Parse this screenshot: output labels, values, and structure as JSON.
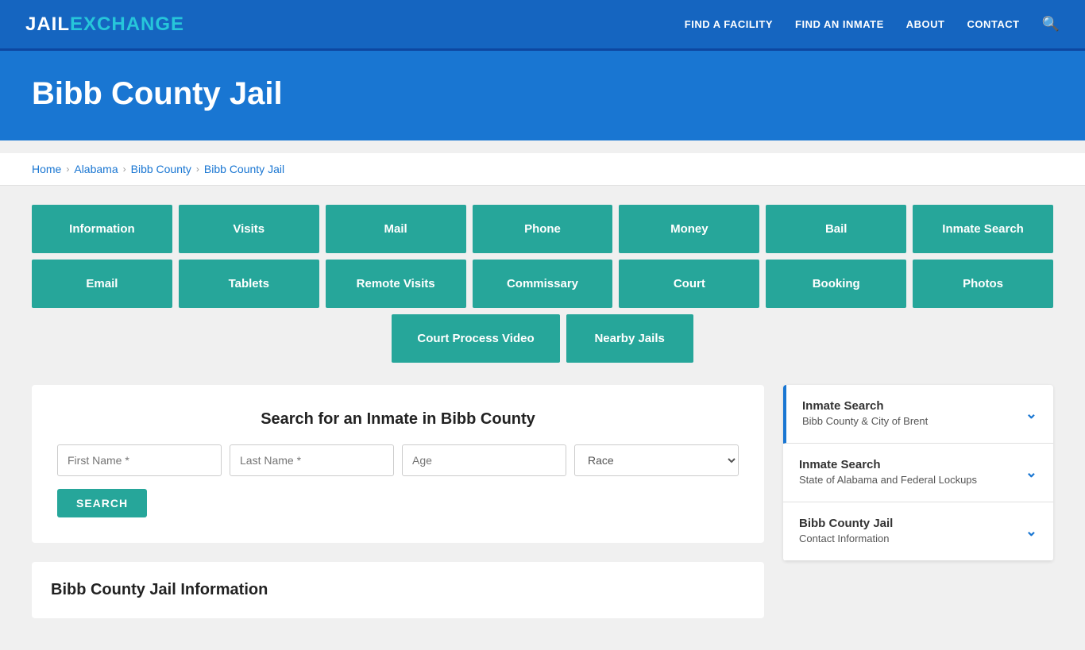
{
  "brand": {
    "jail": "JAIL",
    "exchange": "EXCHANGE"
  },
  "nav": {
    "items": [
      {
        "label": "FIND A FACILITY",
        "id": "find-facility"
      },
      {
        "label": "FIND AN INMATE",
        "id": "find-inmate"
      },
      {
        "label": "ABOUT",
        "id": "about"
      },
      {
        "label": "CONTACT",
        "id": "contact"
      }
    ]
  },
  "hero": {
    "title": "Bibb County Jail"
  },
  "breadcrumb": {
    "items": [
      {
        "label": "Home",
        "href": "#"
      },
      {
        "label": "Alabama",
        "href": "#"
      },
      {
        "label": "Bibb County",
        "href": "#"
      },
      {
        "label": "Bibb County Jail",
        "href": "#"
      }
    ]
  },
  "navButtons": {
    "row1": [
      {
        "label": "Information"
      },
      {
        "label": "Visits"
      },
      {
        "label": "Mail"
      },
      {
        "label": "Phone"
      },
      {
        "label": "Money"
      },
      {
        "label": "Bail"
      },
      {
        "label": "Inmate Search"
      }
    ],
    "row2": [
      {
        "label": "Email"
      },
      {
        "label": "Tablets"
      },
      {
        "label": "Remote Visits"
      },
      {
        "label": "Commissary"
      },
      {
        "label": "Court"
      },
      {
        "label": "Booking"
      },
      {
        "label": "Photos"
      }
    ],
    "row3": [
      {
        "label": "Court Process Video"
      },
      {
        "label": "Nearby Jails"
      }
    ]
  },
  "searchSection": {
    "title": "Search for an Inmate in Bibb County",
    "fields": {
      "firstName": {
        "placeholder": "First Name *"
      },
      "lastName": {
        "placeholder": "Last Name *"
      },
      "age": {
        "placeholder": "Age"
      },
      "race": {
        "placeholder": "Race",
        "label": "Race"
      }
    },
    "searchButton": "SEARCH"
  },
  "infoSection": {
    "title": "Bibb County Jail Information"
  },
  "sidebar": {
    "items": [
      {
        "title": "Inmate Search",
        "subtitle": "Bibb County & City of Brent"
      },
      {
        "title": "Inmate Search",
        "subtitle": "State of Alabama and Federal Lockups"
      },
      {
        "title": "Bibb County Jail",
        "subtitle": "Contact Information"
      }
    ]
  }
}
